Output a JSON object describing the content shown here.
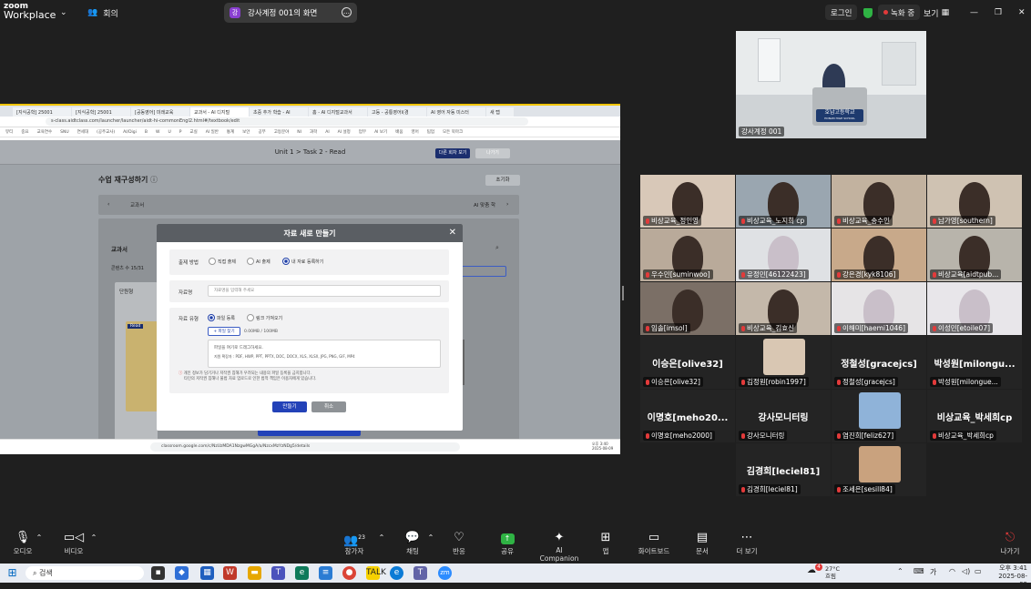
{
  "zoom": {
    "logo_line1": "zoom",
    "logo_line2": "Workplace",
    "meetings_label": "회의",
    "share_title": "강사계정 001의 화면",
    "share_avatar": "강",
    "login_label": "로그인",
    "recording_label": "녹화 중",
    "view_label": "보기"
  },
  "browser": {
    "tabs": [
      "[지식공학] 25001",
      "[지식공학] 25001",
      "[공동영어] 미래교육",
      "교과서 - AI 디지털",
      "초중 추가 학습 - AI",
      "홈 - AI 디지털교과서",
      "고등 - 공통영어I(경",
      "AI 영어 자동 미스터",
      "새 탭"
    ],
    "url": "s-class.aidtclass.com/launcher/launcher/aidt-hi-commonEngl2.html#/textbook/edit",
    "bookmarks": [
      "뷰티",
      "중요",
      "교육연수",
      "SNU",
      "연세대",
      "(공주교사)",
      "AI/Digi",
      "B",
      "W",
      "U",
      "P",
      "교실",
      "AI 일반",
      "통계",
      "보안",
      "공부",
      "고등분야",
      "NI",
      "과학",
      "AI",
      "AI 설정",
      "업무",
      "AI 보기",
      "배움",
      "영어",
      "팀업",
      "모든 북마크"
    ],
    "bottom_url": "classroom.google.com/c/NzUzMDA1NzgwMGgA/a/NzcxMzYzNDg5/details",
    "bottom_time": "오후 3:40",
    "bottom_date": "2025-08-09"
  },
  "page": {
    "header_title": "Unit 1 > Task 2 - Read",
    "other_button": "다른 회차 보기",
    "exit_button": "나가기",
    "section_title": "수업 재구성하기",
    "reset_button": "초기화",
    "tab_textbook": "교과서",
    "tab_ai": "AI 맞춤 학",
    "panel_title": "교과서",
    "content_label": "콘텐츠 수 15/31",
    "unit_label": "단원형",
    "read_badge": "Read",
    "pagination": "1",
    "save_button": "저장 하기"
  },
  "modal": {
    "title": "자료 새로 만들기",
    "method_label": "출제 방법",
    "method_options": [
      "직접 출제",
      "AI 출제",
      "내 자료 등록하기"
    ],
    "name_label": "자료명",
    "name_placeholder": "자료명을 입력해 주세요",
    "type_label": "자료 유형",
    "type_options": [
      "파일 등록",
      "링크 가져오기"
    ],
    "find_file": "+ 파일 찾기",
    "size_text": "0.00MB / 100MB",
    "drop_text": "파일을 여기로 드래그하세요.",
    "formats_text": "지원 확장자 : PDF, HWP, PPT, PPTX, DOC, DOCX, XLS, XLSX, JPG, PNG, GIF, MP4",
    "warning1": "개인 정보가 담기거나 저작권 침해가 우려되는 내용의 파일 등록을 금지합니다.",
    "warning2": "타인의 저작권 침해나 불법 자료 업로드로 인한 법적 책임은 이용자에게 있습니다.",
    "create_button": "만들기",
    "cancel_button": "취소"
  },
  "main_video": {
    "name": "강사계정 001",
    "sign": "호남고등학교",
    "sign_sub": "HONAM HIGH SCHOOL"
  },
  "participants": [
    "비상교육_정인영",
    "비상교육_노지희 cp",
    "비상교육_송수인",
    "남가영[southern]",
    "우수민[suminwoo]",
    "유정민[46122423]",
    "강은경[kyk8106]",
    "비상교육[aidtpub...",
    "임솔[imsol]",
    "비상교육_김효신",
    "이해미[haemi1046]",
    "이성민[etoile07]",
    "이승은[olive32]",
    "김정원[robin1997]",
    "정철성[gracejcs]",
    "박성원[milongue...",
    "이명호[meho2000]",
    "강사모니터링",
    "염진희[feliz627]",
    "비상교육_박세희cp",
    "김경희[leciel81]",
    "조세은[sesill84]"
  ],
  "big_names": [
    "이승은[olive32]",
    "정철성[gracejcs]",
    "박성원[milongu...",
    "이명호[meho20...",
    "강사모니터링",
    "비상교육_박세희cp",
    "김경희[leciel81]"
  ],
  "toolbar": {
    "audio": "오디오",
    "video": "비디오",
    "participants": "참가자",
    "participants_count": "23",
    "chat": "채팅",
    "reactions": "반응",
    "share": "공유",
    "ai": "AI Companion",
    "apps": "앱",
    "whiteboard": "화이트보드",
    "docs": "문서",
    "more": "더 보기",
    "leave": "나가기"
  },
  "taskbar": {
    "search": "검색",
    "temp": "27°C",
    "weather": "흐림",
    "weather_badge": "4",
    "ime": "가",
    "time": "오후 3:41",
    "date": "2025-08-09"
  },
  "colors": {
    "accent": "#1b2e6e",
    "record": "#e23a3a",
    "share_border": "#f0c400",
    "save_button": "#2342b8"
  }
}
